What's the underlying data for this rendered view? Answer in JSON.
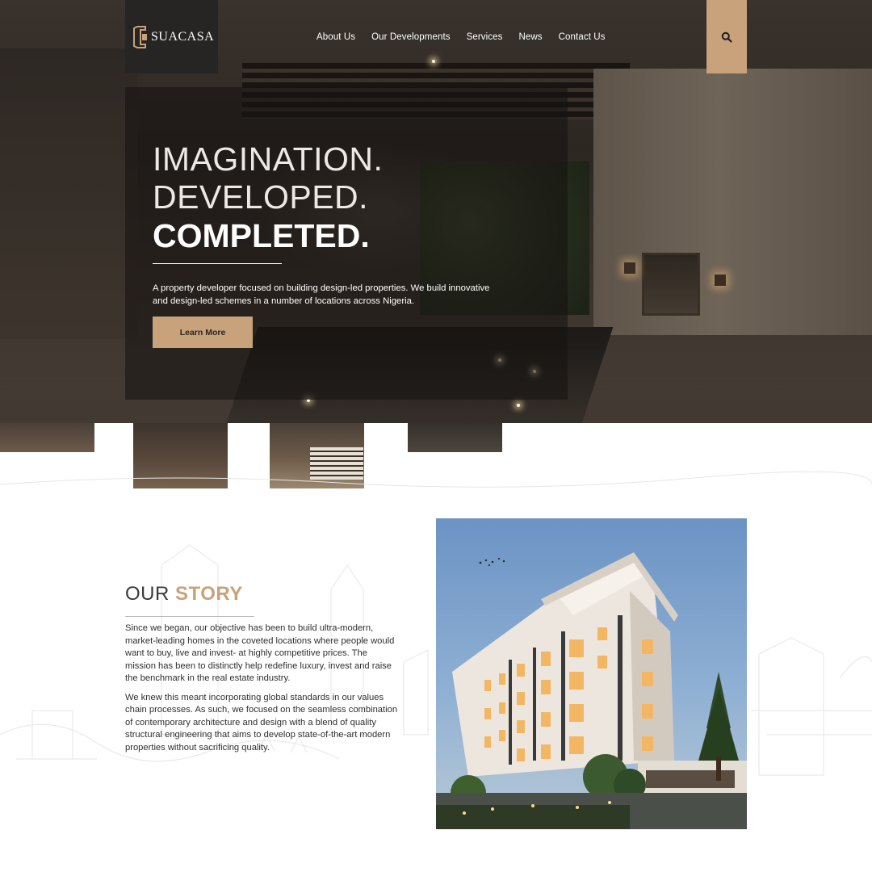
{
  "brand": {
    "name": "SUACASA",
    "accent": "#c7a27a",
    "dark": "#262523"
  },
  "nav": {
    "items": [
      {
        "label": "About Us"
      },
      {
        "label": "Our Developments"
      },
      {
        "label": "Services"
      },
      {
        "label": "News"
      },
      {
        "label": "Contact Us"
      }
    ],
    "search_icon": "search-icon"
  },
  "hero": {
    "line1": "IMAGINATION.",
    "line2": "DEVELOPED.",
    "line3": "COMPLETED.",
    "description": "A property developer focused on building design-led properties. We build innovative and design-led schemes in a number of locations across Nigeria.",
    "cta_label": "Learn More"
  },
  "story": {
    "title_light": "OUR",
    "title_bold": "STORY",
    "paragraph1": "Since we began, our objective has been to build ultra-modern, market-leading homes in the coveted locations where people would want to buy, live and invest- at highly competitive prices. The mission has been to distinctly help redefine luxury, invest and raise the benchmark in the real estate industry.",
    "paragraph2": "We knew this meant incorporating global standards in our values chain processes. As such, we focused on the seamless combination of contemporary architecture and design with a blend of quality structural engineering that aims to develop state-of-the-art modern properties without sacrificing quality."
  }
}
